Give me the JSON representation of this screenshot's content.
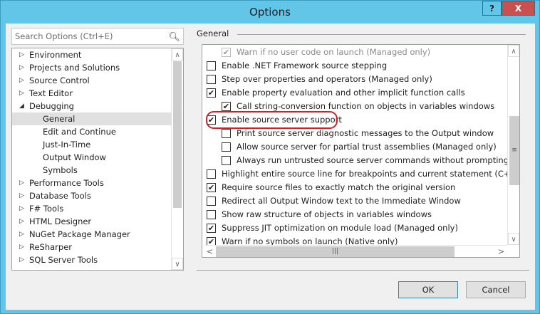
{
  "window": {
    "title": "Options",
    "help_label": "?",
    "close_label": "X"
  },
  "search": {
    "placeholder": "Search Options (Ctrl+E)"
  },
  "tree": [
    {
      "label": "Environment",
      "level": 0,
      "expander": true
    },
    {
      "label": "Projects and Solutions",
      "level": 0,
      "expander": true
    },
    {
      "label": "Source Control",
      "level": 0,
      "expander": true
    },
    {
      "label": "Text Editor",
      "level": 0,
      "expander": true
    },
    {
      "label": "Debugging",
      "level": 0,
      "expander": true,
      "expanded": true
    },
    {
      "label": "General",
      "level": 1,
      "selected": true
    },
    {
      "label": "Edit and Continue",
      "level": 1
    },
    {
      "label": "Just-In-Time",
      "level": 1
    },
    {
      "label": "Output Window",
      "level": 1
    },
    {
      "label": "Symbols",
      "level": 1
    },
    {
      "label": "Performance Tools",
      "level": 0,
      "expander": true
    },
    {
      "label": "Database Tools",
      "level": 0,
      "expander": true
    },
    {
      "label": "F# Tools",
      "level": 0,
      "expander": true
    },
    {
      "label": "HTML Designer",
      "level": 0,
      "expander": true
    },
    {
      "label": "NuGet Package Manager",
      "level": 0,
      "expander": true
    },
    {
      "label": "ReSharper",
      "level": 0,
      "expander": true
    },
    {
      "label": "SQL Server Tools",
      "level": 0,
      "expander": true
    }
  ],
  "group_label": "General",
  "options": [
    {
      "label": "Warn if no user code on launch (Managed only)",
      "indent": 1,
      "checked": true,
      "disabled": true
    },
    {
      "label": "Enable .NET Framework source stepping",
      "indent": 0,
      "checked": false
    },
    {
      "label": "Step over properties and operators (Managed only)",
      "indent": 0,
      "checked": false
    },
    {
      "label": "Enable property evaluation and other implicit function calls",
      "indent": 0,
      "checked": true
    },
    {
      "label": "Call string-conversion function on objects in variables windows",
      "indent": 1,
      "checked": true
    },
    {
      "label": "Enable source server support",
      "indent": 0,
      "checked": true,
      "highlighted": true
    },
    {
      "label": "Print source server diagnostic messages to the Output window",
      "indent": 1,
      "checked": false
    },
    {
      "label": "Allow source server for partial trust assemblies (Managed only)",
      "indent": 1,
      "checked": false
    },
    {
      "label": "Always run untrusted source server commands without prompting",
      "indent": 1,
      "checked": false
    },
    {
      "label": "Highlight entire source line for breakpoints and current statement (C++ only)",
      "indent": 0,
      "checked": false
    },
    {
      "label": "Require source files to exactly match the original version",
      "indent": 0,
      "checked": true
    },
    {
      "label": "Redirect all Output Window text to the Immediate Window",
      "indent": 0,
      "checked": false
    },
    {
      "label": "Show raw structure of objects in variables windows",
      "indent": 0,
      "checked": false
    },
    {
      "label": "Suppress JIT optimization on module load (Managed only)",
      "indent": 0,
      "checked": true
    },
    {
      "label": "Warn if no symbols on launch (Native only)",
      "indent": 0,
      "checked": true
    }
  ],
  "buttons": {
    "ok": "OK",
    "cancel": "Cancel"
  }
}
